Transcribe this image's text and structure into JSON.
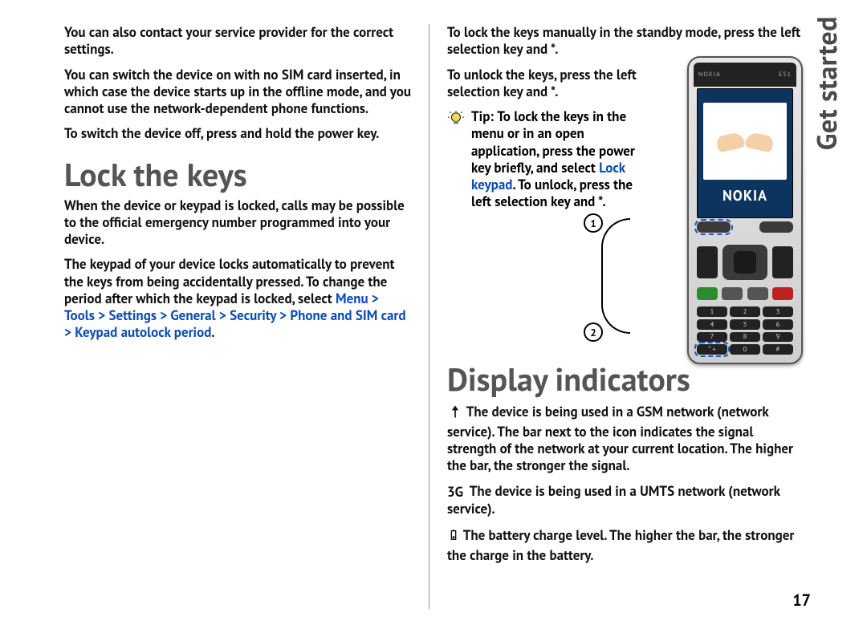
{
  "side_tab": "Get started",
  "page_number": "17",
  "left": {
    "p1": "You can also contact your service provider for the correct settings.",
    "p2": "You can switch the device on with no SIM card inserted, in which case the device starts up in the offline mode, and you cannot use the network-dependent phone functions.",
    "p3": "To switch the device off, press and hold the power key.",
    "h_lock": "Lock the keys",
    "p4": "When the device or keypad is locked, calls may be possible to the official emergency number programmed into your device.",
    "p5_a": "The keypad of your device locks automatically to prevent the keys from being accidentally pressed. To change the period after which the keypad is locked, select ",
    "p5_path": "Menu  >  Tools  >  Settings  >  General  >  Security  >  Phone and SIM card  >  Keypad autolock period",
    "p5_c": "."
  },
  "right": {
    "p1": "To lock the keys manually in the standby mode, press the left selection key and *.",
    "p2": "To unlock the keys, press the left selection key and *.",
    "tip_bold": "Tip: ",
    "tip_a": "To lock the keys in the menu or in an open application, press the power key briefly, and select ",
    "tip_path": "Lock keypad",
    "tip_b": ". To unlock, press the left selection key and *.",
    "h_display": "Display indicators",
    "ind1": "The device is being used in a GSM network (network service). The bar next to the icon indicates the signal strength of the network at your current location. The higher the bar, the stronger the signal.",
    "ind2_label": "3G",
    "ind2": "The device is being used in a UMTS network (network service).",
    "ind3": "The battery charge level. The higher the bar, the stronger the charge in the battery."
  },
  "phone": {
    "brand_small": "NOKIA",
    "model": "E51",
    "logo": "NOKIA",
    "callout1": "1",
    "callout2": "2",
    "keys": [
      "1",
      "2",
      "3",
      "4",
      "5",
      "6",
      "7",
      "8",
      "9",
      "* +",
      "0",
      "#"
    ]
  }
}
